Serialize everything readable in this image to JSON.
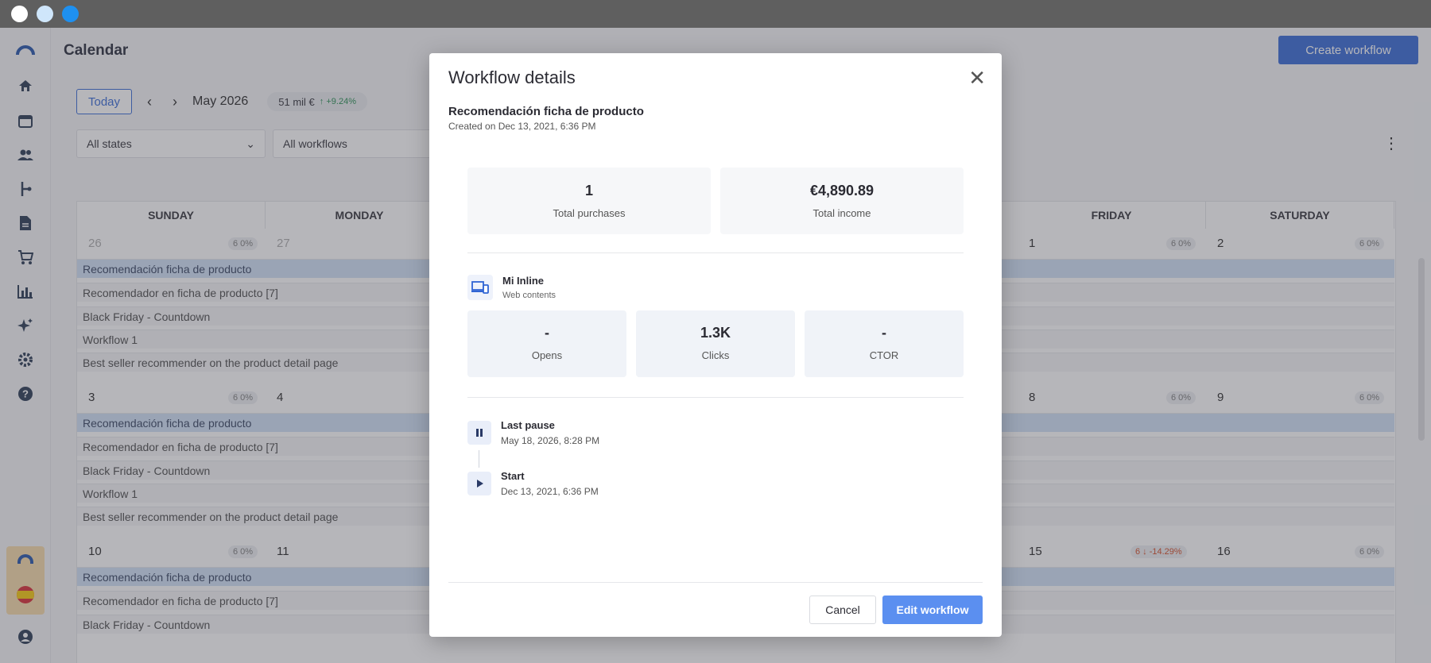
{
  "window": {
    "controls": [
      "close",
      "minimize",
      "maximize"
    ]
  },
  "header": {
    "title": "Calendar",
    "create_label": "Create workflow"
  },
  "toolbar": {
    "today": "Today",
    "month": "May 2026",
    "kpi_value": "51 mil €",
    "kpi_change": "+9.24%"
  },
  "filters": {
    "states": "All states",
    "workflows": "All workflows"
  },
  "calendar": {
    "days": [
      "SUNDAY",
      "MONDAY",
      "FRIDAY",
      "SATURDAY"
    ],
    "week1": {
      "sun": "26",
      "mon": "27",
      "fri": "1",
      "sat": "2",
      "badge": "6 0%"
    },
    "week2": {
      "sun": "3",
      "mon": "4",
      "fri": "8",
      "sat": "9",
      "badge": "6 0%"
    },
    "week3": {
      "sun": "10",
      "mon": "11",
      "fri": "15",
      "sat": "16",
      "badge": "6 0%",
      "fri_badge": "6 ↓ -14.29%"
    },
    "workflows": [
      "Recomendación ficha de producto",
      "Recomendador en ficha de producto [7]",
      "Black Friday - Countdown",
      "Workflow 1",
      "Best seller recommender on the product detail page"
    ]
  },
  "modal": {
    "title": "Workflow details",
    "name": "Recomendación ficha de producto",
    "created": "Created on Dec 13, 2021, 6:36 PM",
    "stats": [
      {
        "value": "1",
        "label": "Total purchases"
      },
      {
        "value": "€4,890.89",
        "label": "Total income"
      }
    ],
    "channel": {
      "name": "Mi Inline",
      "type": "Web contents"
    },
    "metrics": [
      {
        "value": "-",
        "label": "Opens"
      },
      {
        "value": "1.3K",
        "label": "Clicks"
      },
      {
        "value": "-",
        "label": "CTOR"
      }
    ],
    "events": [
      {
        "title": "Last pause",
        "date": "May 18, 2026, 8:28 PM"
      },
      {
        "title": "Start",
        "date": "Dec 13, 2021, 6:36 PM"
      }
    ],
    "cancel_label": "Cancel",
    "edit_label": "Edit workflow"
  },
  "colors": {
    "accent": "#2f64d4",
    "edit_button": "#5b8ff0",
    "highlight_row": "#cfe0f6"
  }
}
